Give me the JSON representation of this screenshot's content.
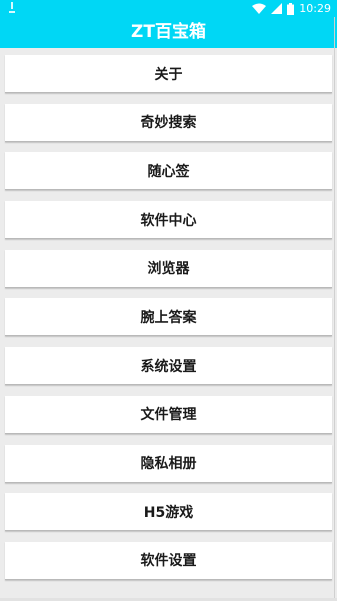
{
  "status_bar": {
    "time": "10:29",
    "icons": [
      "notification-icon",
      "wifi-icon",
      "signal-icon",
      "battery-icon"
    ]
  },
  "app_bar": {
    "title": "ZT百宝箱"
  },
  "colors": {
    "accent": "#00d7f5",
    "background": "#ececec",
    "card": "#ffffff",
    "text": "#1a1a1a"
  },
  "menu": {
    "items": [
      {
        "label": "关于"
      },
      {
        "label": "奇妙搜索"
      },
      {
        "label": "随心签"
      },
      {
        "label": "软件中心"
      },
      {
        "label": "浏览器"
      },
      {
        "label": "腕上答案"
      },
      {
        "label": "系统设置"
      },
      {
        "label": "文件管理"
      },
      {
        "label": "隐私相册"
      },
      {
        "label": "H5游戏"
      },
      {
        "label": "软件设置"
      }
    ]
  }
}
